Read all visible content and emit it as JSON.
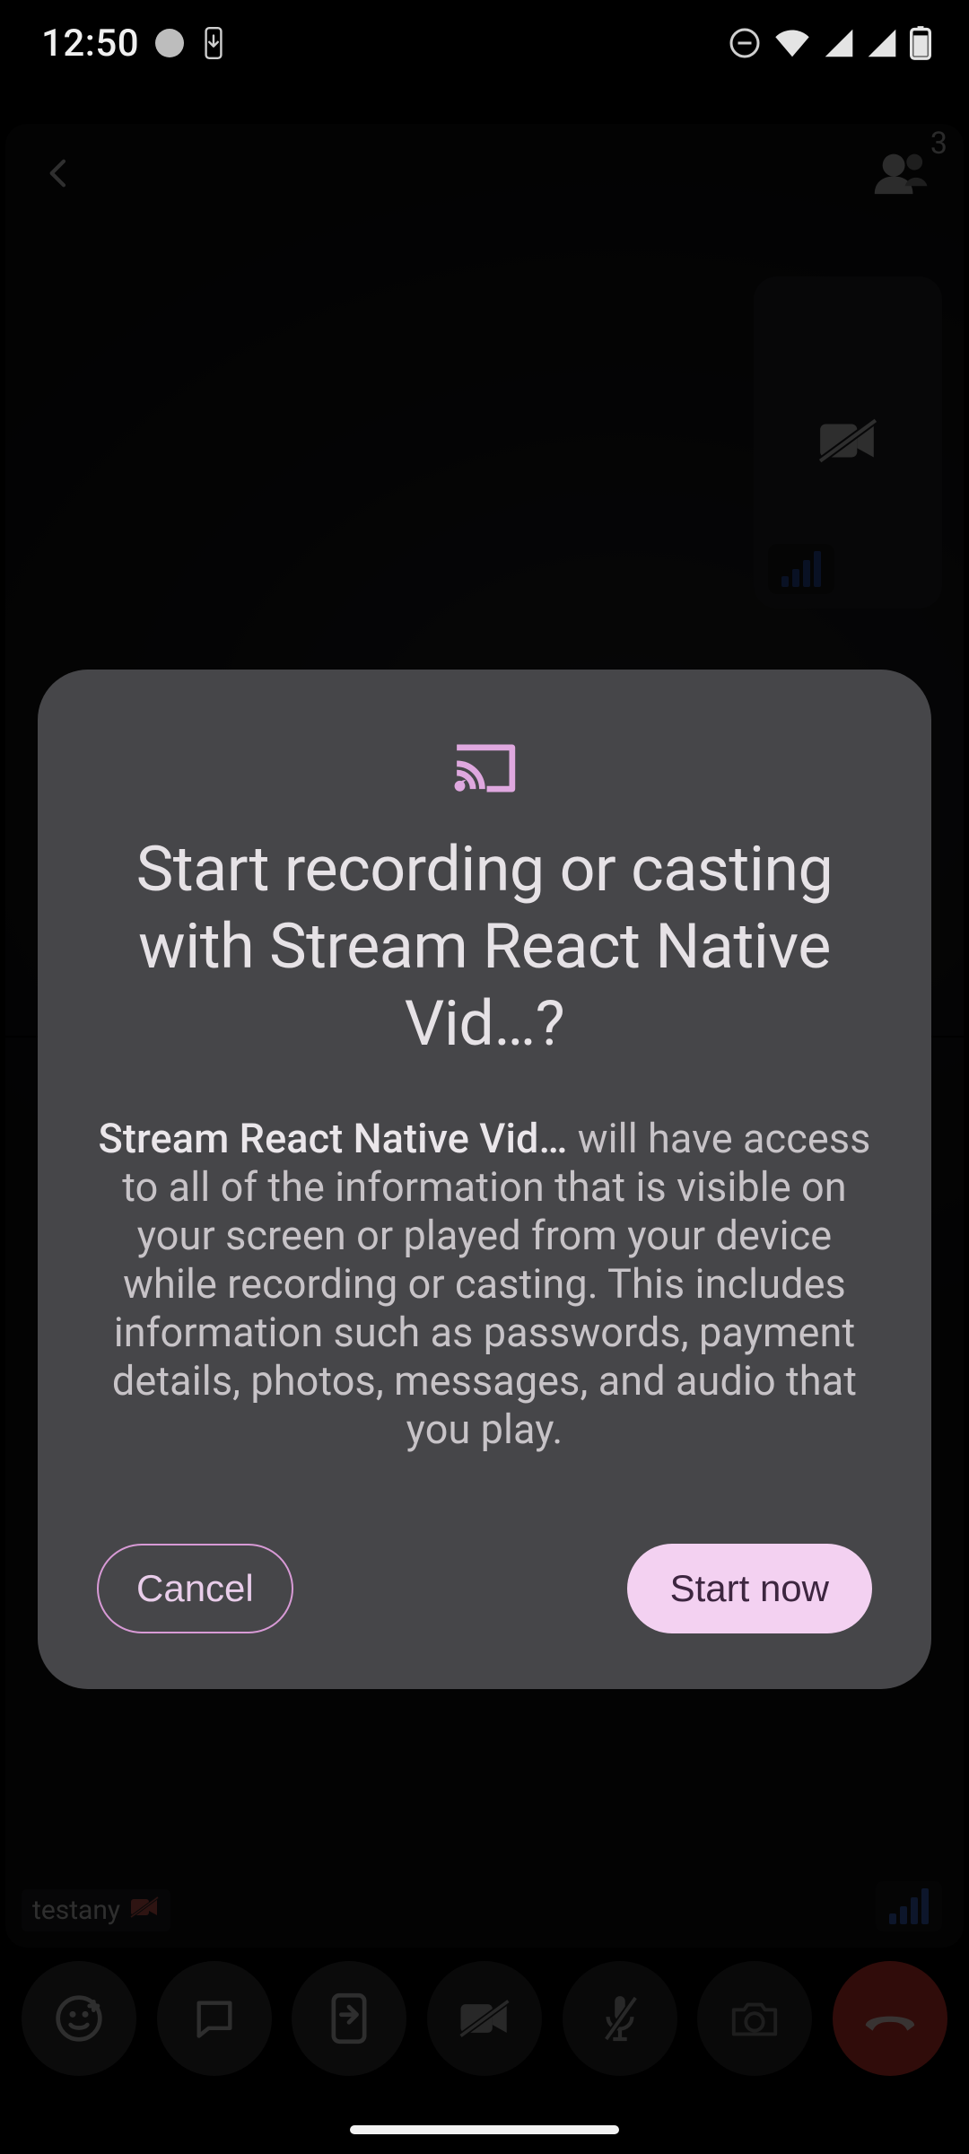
{
  "status": {
    "time": "12:50"
  },
  "call": {
    "participant_count": "3",
    "remote_name": "testany"
  },
  "dialog": {
    "title": "Start recording or casting with Stream React Native Vid…?",
    "app_name": "Stream React Native Vid…",
    "body_rest": " will have access to all of the information that is visible on your screen or played from your device while recording or casting. This includes information such as passwords, payment details, photos, messages, and audio that you play.",
    "cancel_label": "Cancel",
    "start_label": "Start now"
  }
}
